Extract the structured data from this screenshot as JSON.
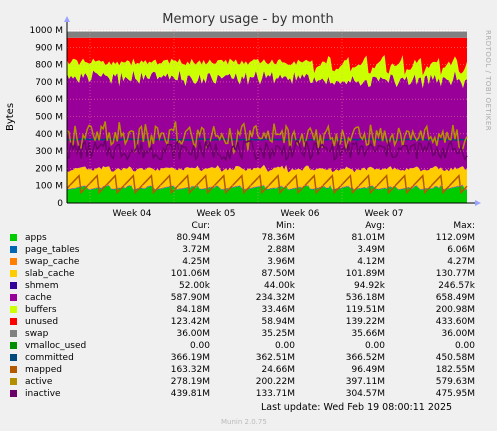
{
  "chart_data": {
    "type": "area",
    "title": "Memory usage - by month",
    "ylabel": "Bytes",
    "side_label": "RRDTOOL / TOBI OETIKER",
    "ylim": [
      0,
      1000000000
    ],
    "y_ticks": [
      {
        "value": 0,
        "label": "0"
      },
      {
        "value": 100000000,
        "label": "100 M"
      },
      {
        "value": 200000000,
        "label": "200 M"
      },
      {
        "value": 300000000,
        "label": "300 M"
      },
      {
        "value": 400000000,
        "label": "400 M"
      },
      {
        "value": 500000000,
        "label": "500 M"
      },
      {
        "value": 600000000,
        "label": "600 M"
      },
      {
        "value": 700000000,
        "label": "700 M"
      },
      {
        "value": 800000000,
        "label": "800 M"
      },
      {
        "value": 900000000,
        "label": "900 M"
      },
      {
        "value": 1000000000,
        "label": "1000 M"
      }
    ],
    "x_ticks": [
      "Week 04",
      "Week 05",
      "Week 06",
      "Week 07"
    ],
    "grid": true,
    "series": [
      {
        "name": "apps",
        "color": "#00cc00",
        "stacked": true,
        "approx_mb": 80
      },
      {
        "name": "page_tables",
        "color": "#0066b3",
        "stacked": true,
        "approx_mb": 3.5
      },
      {
        "name": "swap_cache",
        "color": "#ff8000",
        "stacked": true,
        "approx_mb": 4
      },
      {
        "name": "slab_cache",
        "color": "#ffcc00",
        "stacked": true,
        "approx_mb": 100
      },
      {
        "name": "shmem",
        "color": "#330099",
        "stacked": true,
        "approx_mb": 0.1
      },
      {
        "name": "cache",
        "color": "#990099",
        "stacked": true,
        "approx_mb": 540
      },
      {
        "name": "buffers",
        "color": "#ccff00",
        "stacked": true,
        "approx_mb": 120
      },
      {
        "name": "unused",
        "color": "#ff0000",
        "stacked": true,
        "approx_mb": 140
      },
      {
        "name": "swap",
        "color": "#808080",
        "stacked": true,
        "approx_mb": 36
      },
      {
        "name": "vmalloc_used",
        "color": "#008f00",
        "stacked": false
      },
      {
        "name": "committed",
        "color": "#00487d",
        "stacked": false,
        "approx_mb": 366
      },
      {
        "name": "mapped",
        "color": "#b35a00",
        "stacked": false,
        "approx_mb": 96
      },
      {
        "name": "active",
        "color": "#b38f00",
        "stacked": false,
        "approx_mb": 397
      },
      {
        "name": "inactive",
        "color": "#6b006b",
        "stacked": false,
        "approx_mb": 305
      }
    ]
  },
  "legend": {
    "headers": {
      "cur": "Cur:",
      "min": "Min:",
      "avg": "Avg:",
      "max": "Max:"
    },
    "rows": [
      {
        "name": "apps",
        "color": "#00cc00",
        "cur": "80.94M",
        "min": "78.36M",
        "avg": "81.01M",
        "max": "112.09M"
      },
      {
        "name": "page_tables",
        "color": "#0066b3",
        "cur": "3.72M",
        "min": "2.88M",
        "avg": "3.49M",
        "max": "6.06M"
      },
      {
        "name": "swap_cache",
        "color": "#ff8000",
        "cur": "4.25M",
        "min": "3.96M",
        "avg": "4.12M",
        "max": "4.27M"
      },
      {
        "name": "slab_cache",
        "color": "#ffcc00",
        "cur": "101.06M",
        "min": "87.50M",
        "avg": "101.89M",
        "max": "130.77M"
      },
      {
        "name": "shmem",
        "color": "#330099",
        "cur": "52.00k",
        "min": "44.00k",
        "avg": "94.92k",
        "max": "246.57k"
      },
      {
        "name": "cache",
        "color": "#990099",
        "cur": "587.90M",
        "min": "234.32M",
        "avg": "536.18M",
        "max": "658.49M"
      },
      {
        "name": "buffers",
        "color": "#ccff00",
        "cur": "84.18M",
        "min": "33.46M",
        "avg": "119.51M",
        "max": "200.98M"
      },
      {
        "name": "unused",
        "color": "#ff0000",
        "cur": "123.42M",
        "min": "58.94M",
        "avg": "139.22M",
        "max": "433.60M"
      },
      {
        "name": "swap",
        "color": "#808080",
        "cur": "36.00M",
        "min": "35.25M",
        "avg": "35.66M",
        "max": "36.00M"
      },
      {
        "name": "vmalloc_used",
        "color": "#008f00",
        "cur": "0.00",
        "min": "0.00",
        "avg": "0.00",
        "max": "0.00"
      },
      {
        "name": "committed",
        "color": "#00487d",
        "cur": "366.19M",
        "min": "362.51M",
        "avg": "366.52M",
        "max": "450.58M"
      },
      {
        "name": "mapped",
        "color": "#b35a00",
        "cur": "163.32M",
        "min": "24.66M",
        "avg": "96.49M",
        "max": "182.55M"
      },
      {
        "name": "active",
        "color": "#b38f00",
        "cur": "278.19M",
        "min": "200.22M",
        "avg": "397.11M",
        "max": "579.63M"
      },
      {
        "name": "inactive",
        "color": "#6b006b",
        "cur": "439.81M",
        "min": "133.71M",
        "avg": "304.57M",
        "max": "475.95M"
      }
    ]
  },
  "footer": {
    "last_update": "Last update: Wed Feb 19 08:00:11 2025",
    "version": "Munin 2.0.75"
  }
}
